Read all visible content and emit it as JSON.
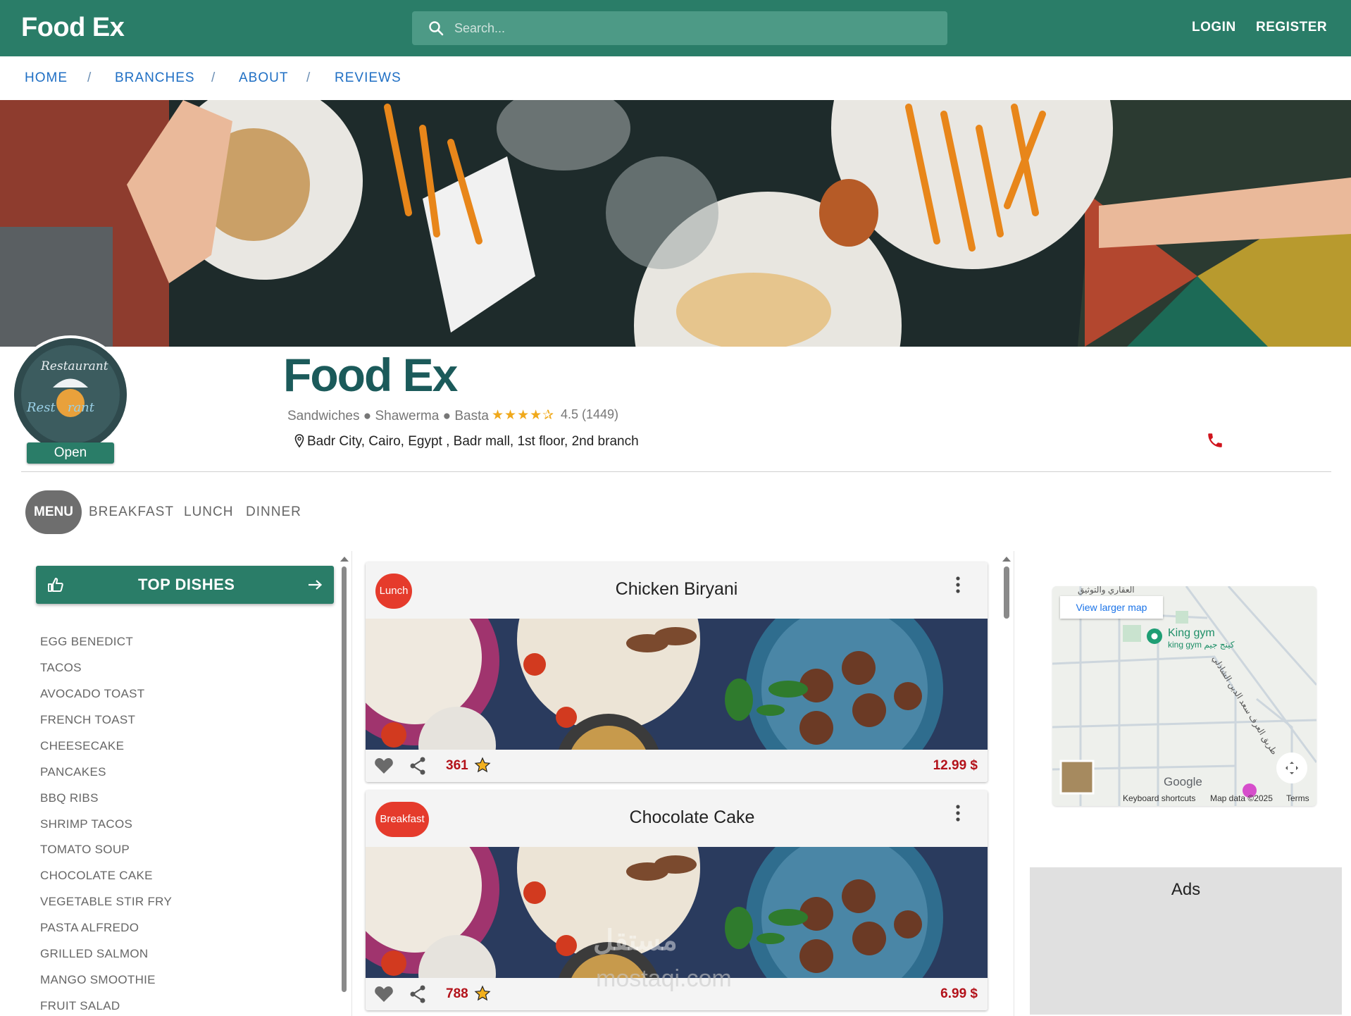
{
  "topbar": {
    "brand": "Food Ex",
    "search_placeholder": "Search...",
    "login": "LOGIN",
    "register": "REGISTER"
  },
  "breadcrumbs": [
    "HOME",
    "BRANCHES",
    "ABOUT",
    "REVIEWS"
  ],
  "breadcrumb_sep": "/",
  "restaurant": {
    "logo_text_top": "Restaurant",
    "logo_text_bottom": "Rest   rant",
    "status": "Open",
    "name": "Food Ex",
    "categories": "Sandwiches ● Shawerma ● Basta",
    "stars": "★★★★✰",
    "rating": "4.5 (1449)",
    "address": "Badr City, Cairo, Egypt , Badr mall, 1st floor, 2nd branch"
  },
  "menu_tabs": {
    "active": "MENU",
    "others": [
      "BREAKFAST",
      "LUNCH",
      "DINNER"
    ]
  },
  "top_dishes": {
    "label": "TOP DISHES",
    "items": [
      "EGG BENEDICT",
      "TACOS",
      "AVOCADO TOAST",
      "FRENCH TOAST",
      "CHEESECAKE",
      "PANCAKES",
      "BBQ RIBS",
      "SHRIMP TACOS",
      "TOMATO SOUP",
      "CHOCOLATE CAKE",
      "VEGETABLE STIR FRY",
      "PASTA ALFREDO",
      "GRILLED SALMON",
      "MANGO SMOOTHIE",
      "FRUIT SALAD"
    ]
  },
  "cards": [
    {
      "badge": "Lunch",
      "title": "Chicken Biryani",
      "count": "361",
      "price": "12.99 $"
    },
    {
      "badge": "Breakfast",
      "title": "Chocolate Cake",
      "count": "788",
      "price": "6.99 $"
    }
  ],
  "map": {
    "view_larger": "View larger map",
    "place_name": "King gym",
    "place_sub": "king gym كينج جيم",
    "top_label": "العقاري والتوثيق",
    "street_label": "طريق العرف سعد الدين الشاذلي",
    "google": "Google",
    "keyboard": "Keyboard shortcuts",
    "map_data": "Map data ©2025",
    "terms": "Terms"
  },
  "ads": {
    "label": "Ads"
  },
  "watermark": {
    "arabic": "مستقل",
    "latin": "mostaqi.com"
  },
  "colors": {
    "brand_green": "#2a7d68",
    "link_blue": "#1f6fc4",
    "price_red": "#b3121a",
    "badge_red": "#e53b2c",
    "star_gold": "#f0a91b"
  }
}
